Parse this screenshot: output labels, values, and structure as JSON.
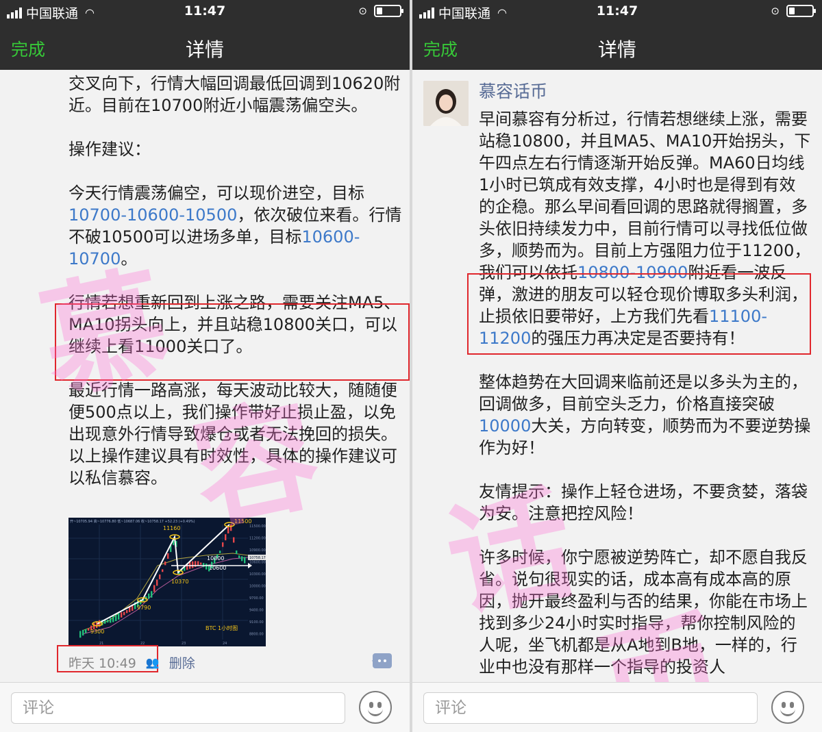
{
  "status": {
    "carrier": "中国联通",
    "time": "11:47"
  },
  "nav": {
    "done_label": "完成",
    "title": "详情"
  },
  "left": {
    "paragraphs": [
      {
        "parts": [
          {
            "text": "交叉向下，行情大幅回调最低回调到10620附近。目前在10700附近小幅震荡偏空头。"
          }
        ]
      },
      {
        "parts": [
          {
            "text": "操作建议："
          }
        ]
      },
      {
        "parts": [
          {
            "text": "今天行情震荡偏空，可以现价进空，目标"
          },
          {
            "text": "10700-10600-10500",
            "link": true
          },
          {
            "text": "，依次破位来看。行情不破10500可以进场多单，目标"
          },
          {
            "text": "10600-10700",
            "link": true
          },
          {
            "text": "。"
          }
        ]
      },
      {
        "parts": [
          {
            "text": "行情若想重新回到上涨之路，需要关注MA5、MA10拐头向上，并且站稳10800关口，可以继续上看11000关口了。"
          }
        ]
      },
      {
        "parts": [
          {
            "text": "最近行情一路高涨，每天波动比较大，随随便便500点以上，我们操作带好止损止盈，以免出现意外行情导致爆仓或者无法挽回的损失。以上操作建议具有时效性，具体的操作建议可以私信慕容。"
          }
        ]
      }
    ],
    "chart": {
      "header": "开~10705.94  高~10776.80  低~10687.06  收~10758.17  +52.23 (+0.49%)",
      "labels": [
        "11160",
        "11500",
        "10800",
        "10600",
        "10370",
        "9790",
        "9300"
      ],
      "price_ticks": [
        "11500.00",
        "11200.00",
        "10900.00",
        "10600.00",
        "10300.00",
        "10000.00",
        "9700.00",
        "9400.00",
        "9100.00",
        "8800.00"
      ],
      "date_ticks": [
        "21",
        "22",
        "23",
        "24"
      ],
      "price_tag": "10758.17",
      "caption": "BTC  1小时图"
    },
    "meta": {
      "time": "昨天 10:49",
      "delete_label": "删除"
    }
  },
  "right": {
    "author": "慕容话币",
    "paragraphs": [
      {
        "parts": [
          {
            "text": "早间慕容有分析过，行情若想继续上涨，需要站稳10800，并且MA5、MA10开始拐头，下午四点左右行情逐渐开始反弹。MA60日均线1小时已筑成有效支撑，4小时也是得到有效的企稳。那么早间看回调的思路就得搁置，多头依旧持续发力中，目前行情可以寻找低位做多，顺势而为。目前上方强阻力位于11200，我们可以依托"
          },
          {
            "text": "10800-10900",
            "link": true
          },
          {
            "text": "附近看一波反弹，激进的朋友可以轻仓现价博取多头利润，止损依旧要带好，上方我们先看"
          },
          {
            "text": "11100-11200",
            "link": true
          },
          {
            "text": "的强压力再决定是否要持有！"
          }
        ]
      },
      {
        "parts": [
          {
            "text": "整体趋势在大回调来临前还是以多头为主的，回调做多，目前空头乏力，价格直接突破"
          },
          {
            "text": "10000",
            "link": true
          },
          {
            "text": "大关，方向转变，顺势而为不要逆势操作为好！"
          }
        ]
      },
      {
        "parts": [
          {
            "text": "友情提示：操作上轻仓进场，不要贪婪，落袋为安。注意把控风险！"
          }
        ]
      },
      {
        "parts": [
          {
            "text": "许多时候，你宁愿被逆势阵亡，却不愿自我反省。说句很现实的话，成本高有成本高的原因，抛开最终盈利与否的结果，你能在市场上找到多少24小时实时指导，帮你控制风险的人呢，坐飞机都是从A地到B地，一样的，行业中也没有那样一个指导的投资人"
          }
        ]
      }
    ]
  },
  "bottom": {
    "comment_placeholder": "评论"
  }
}
